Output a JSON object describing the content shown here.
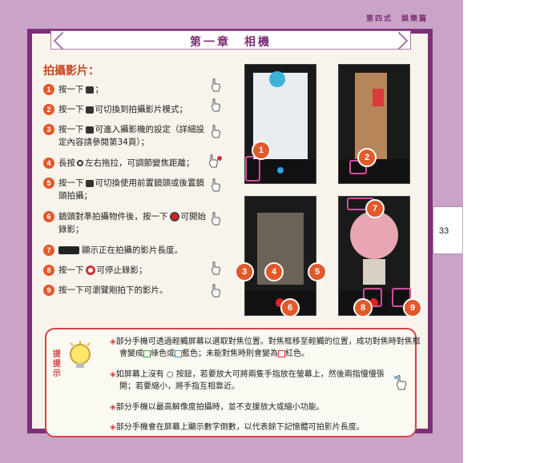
{
  "header": {
    "section": "第四式　娛樂篇"
  },
  "page_number": "33",
  "chapter_title": "第一章　相機",
  "section_title": "拍攝影片：",
  "steps": [
    {
      "n": "1",
      "pre": "按一下",
      "post": "；"
    },
    {
      "n": "2",
      "pre": "按一下",
      "post": "可切換到拍攝影片模式；"
    },
    {
      "n": "3",
      "pre": "按一下",
      "post": "可進入攝影機的設定（詳細設定內容請參閱第34頁）；"
    },
    {
      "n": "4",
      "pre": "長按",
      "post": "左右拖拉，可調節變焦距離；"
    },
    {
      "n": "5",
      "pre": "按一下",
      "post": "可切換使用前置鏡頭或後置鏡頭拍攝；"
    },
    {
      "n": "6",
      "pre": "鏡頭對準拍攝物件後，按一下",
      "post": "可開始錄影；"
    },
    {
      "n": "7",
      "pre": "",
      "post": "顯示正在拍攝的影片長度。"
    },
    {
      "n": "8",
      "pre": "按一下",
      "post": "可停止錄影；"
    },
    {
      "n": "9",
      "pre": "按一下可瀏覽剛拍下的影片。",
      "post": ""
    }
  ],
  "badges": [
    "1",
    "2",
    "3",
    "4",
    "5",
    "6",
    "7",
    "8",
    "9"
  ],
  "tip": {
    "label": "提提示",
    "items": [
      {
        "a": "部分手機可透過輕觸屏幕以選取對焦位置。對焦框移至輕觸的位置，成功對焦時對焦框會變成",
        "g": "綠色或",
        "b": "藍色；未能對焦時則會變為",
        "r": "紅色。"
      },
      {
        "text": "如屏幕上沒有 ○ 按鈕，若要放大可將兩隻手指放在螢幕上，然後兩指慢慢張開；若要縮小，將手指互相靠近。"
      },
      {
        "text": "部分手機以最高解像度拍攝時，並不支援放大或縮小功能。"
      },
      {
        "text": "部分手機會在屏幕上顯示數字倒數，以代表餘下記憶體可拍影片長度。"
      }
    ]
  },
  "colors": {
    "frame": "#7d2f79",
    "accent": "#e2592a",
    "tip_border": "#d24447"
  }
}
